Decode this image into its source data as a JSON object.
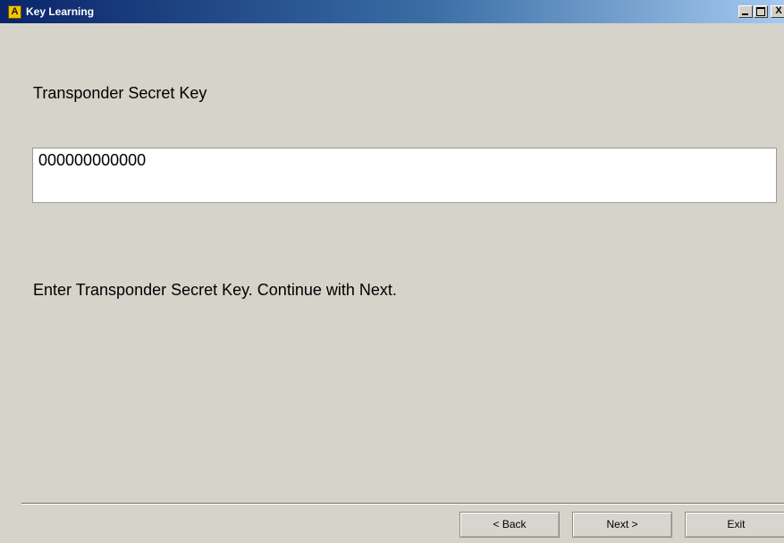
{
  "window": {
    "title": "Key Learning",
    "icon_letter": "A",
    "icon": "app-icon",
    "controls": {
      "minimize": "minimize-icon",
      "maximize": "maximize-icon",
      "close_label": "X",
      "close": "close-icon"
    },
    "colors": {
      "titlebar_start": "#0a246a",
      "titlebar_end": "#a6caf0",
      "background": "#d6d3cb",
      "icon_bg": "#f5c400"
    }
  },
  "form": {
    "heading": "Transponder Secret Key",
    "secret_key_value": "000000000000",
    "instruction": "Enter Transponder Secret Key. Continue with Next."
  },
  "buttons": {
    "back_label": "< Back",
    "next_label": "Next >",
    "exit_label": "Exit"
  }
}
